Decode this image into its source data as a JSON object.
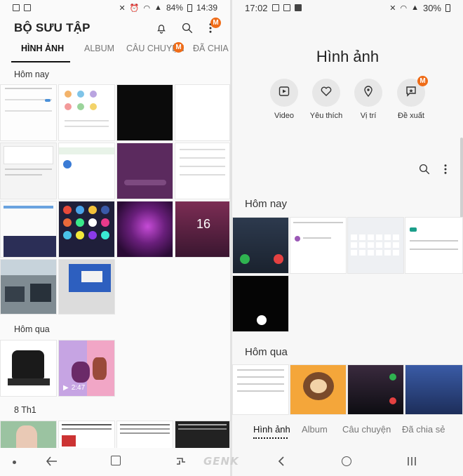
{
  "left": {
    "status": {
      "battery": "84%",
      "time": "14:39"
    },
    "title": "BỘ SƯU TẬP",
    "more_badge": "M",
    "tabs": [
      {
        "label": "HÌNH ẢNH"
      },
      {
        "label": "ALBUM"
      },
      {
        "label": "CÂU CHUYỆN",
        "badge": "M"
      },
      {
        "label": "ĐÃ CHIA"
      }
    ],
    "sections": {
      "today": "Hôm nay",
      "yesterday": "Hôm qua",
      "date": "8 Th1"
    },
    "video_duration": "2:47",
    "lock_time": "16"
  },
  "right": {
    "status": {
      "time": "17:02",
      "battery": "30%"
    },
    "title": "Hình ảnh",
    "categories": [
      {
        "label": "Video",
        "icon": "play-icon"
      },
      {
        "label": "Yêu thích",
        "icon": "heart-icon"
      },
      {
        "label": "Vị trí",
        "icon": "location-icon"
      },
      {
        "label": "Đề xuất",
        "icon": "suggest-icon",
        "badge": "M"
      }
    ],
    "sections": {
      "today": "Hôm nay",
      "yesterday": "Hôm qua"
    },
    "bottom_tabs": [
      {
        "label": "Hình ảnh"
      },
      {
        "label": "Album"
      },
      {
        "label": "Câu chuyện"
      },
      {
        "label": "Đã chia sẻ"
      }
    ]
  },
  "watermark": "GENK"
}
